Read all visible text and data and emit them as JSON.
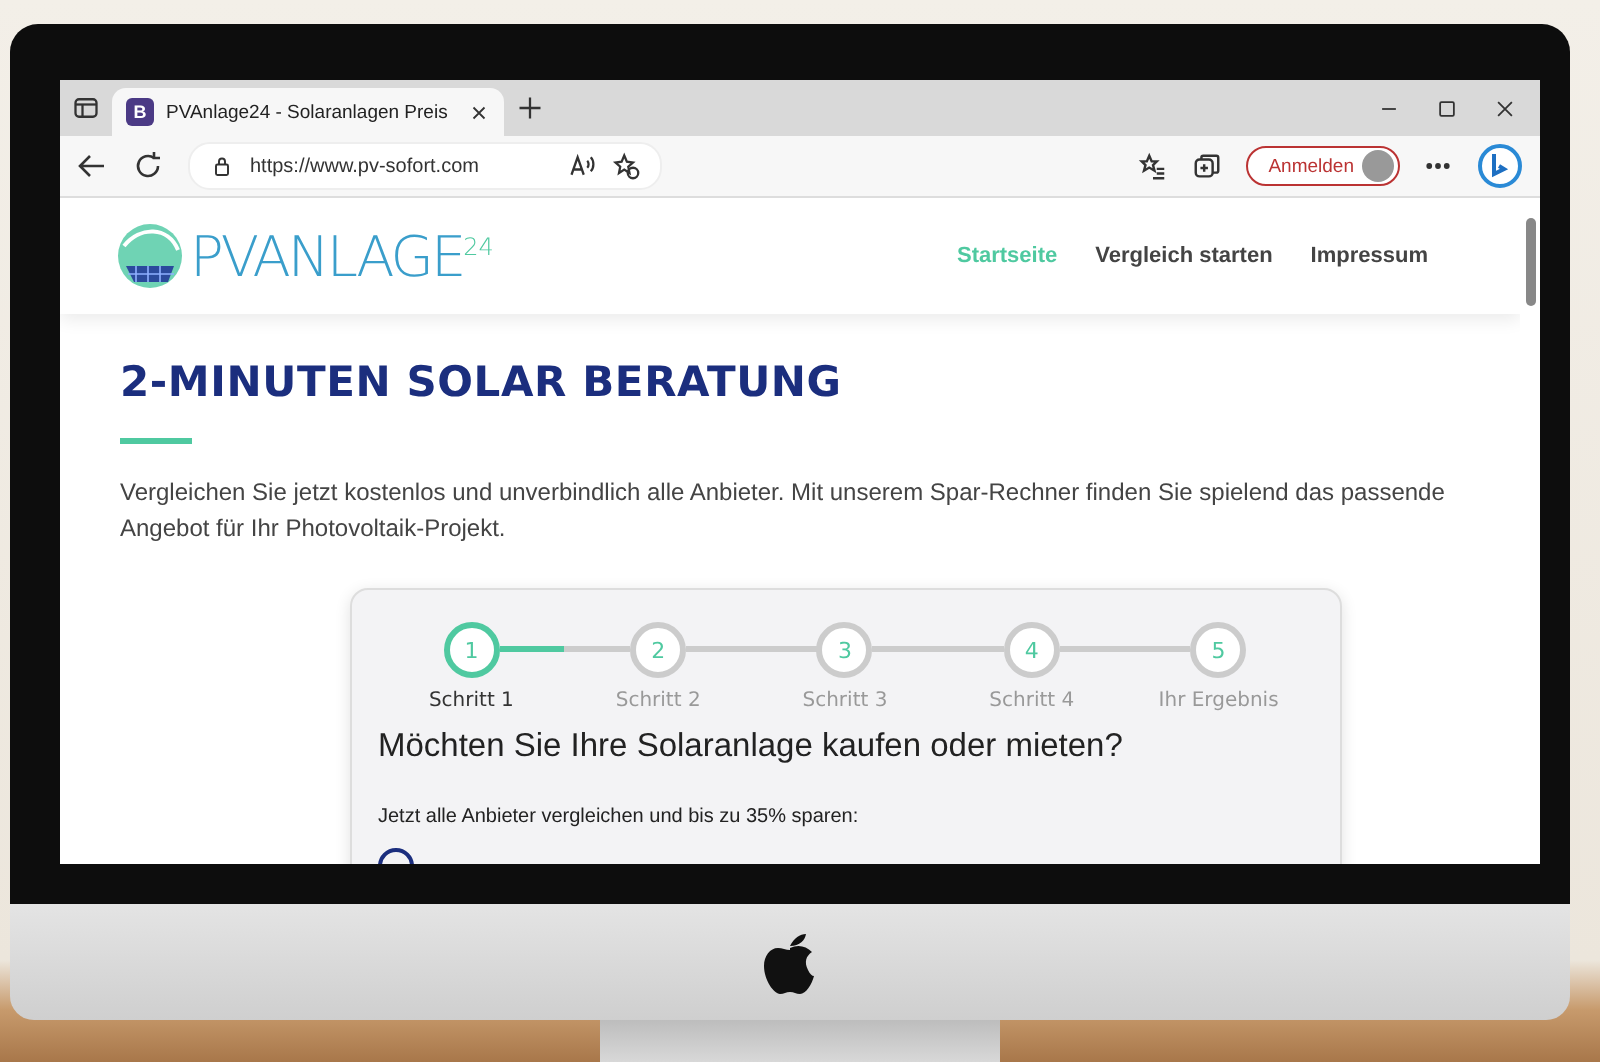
{
  "browser": {
    "tab_title": "PVAnlage24 - Solaranlagen Preis",
    "tab_favicon": "B",
    "url": "https://www.pv-sofort.com",
    "sign_in": "Anmelden"
  },
  "site": {
    "logo_text": "PVANLAGE",
    "logo_sup": "24",
    "nav": [
      {
        "label": "Startseite",
        "selected": true
      },
      {
        "label": "Vergleich starten",
        "selected": false
      },
      {
        "label": "Impressum",
        "selected": false
      }
    ],
    "heading": "2-MINUTEN SOLAR BERATUNG",
    "intro": "Vergleichen Sie jetzt kostenlos und unverbindlich alle Anbieter. Mit unserem Spar-Rechner finden Sie spielend das passende Angebot für Ihr Photovoltaik-Projekt.",
    "wizard": {
      "connectors": [
        {
          "level": 0.5
        },
        {
          "level": 0
        },
        {
          "level": 0
        },
        {
          "level": 0
        }
      ],
      "steps": [
        {
          "number": "1",
          "label": "Schritt 1",
          "selected": true
        },
        {
          "number": "2",
          "label": "Schritt 2",
          "selected": false
        },
        {
          "number": "3",
          "label": "Schritt 3",
          "selected": false
        },
        {
          "number": "4",
          "label": "Schritt 4",
          "selected": false
        },
        {
          "number": "5",
          "label": "Ihr Ergebnis",
          "selected": false
        }
      ],
      "question": "Möchten Sie Ihre Solaranlage kaufen oder mieten?",
      "hint": "Jetzt alle Anbieter vergleichen und bis zu 35% sparen:"
    }
  }
}
